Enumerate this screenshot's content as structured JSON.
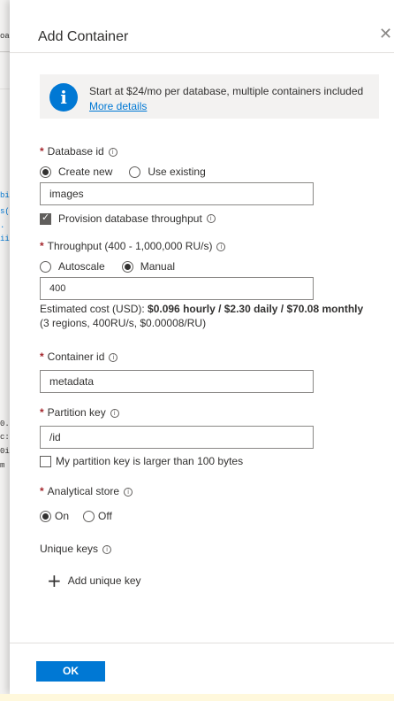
{
  "background": {
    "fragments": [
      "oa",
      "bi",
      "s(",
      ".",
      "ii",
      "0.",
      "c:",
      "0i",
      "m"
    ]
  },
  "dialog": {
    "title": "Add Container",
    "close_icon": "close-icon"
  },
  "info": {
    "icon": "info-icon",
    "text": "Start at $24/mo per database, multiple containers included",
    "link": "More details"
  },
  "database": {
    "label": "Database id",
    "options": [
      "Create new",
      "Use existing"
    ],
    "selected": "Create new",
    "value": "images",
    "provision_label": "Provision database throughput",
    "provision_checked": true
  },
  "throughput": {
    "label": "Throughput (400 - 1,000,000 RU/s)",
    "options": [
      "Autoscale",
      "Manual"
    ],
    "selected": "Manual",
    "value": "400",
    "cost_prefix": "Estimated cost (USD): ",
    "cost_bold": "$0.096 hourly / $2.30 daily / $70.08 monthly",
    "cost_detail": "(3 regions, 400RU/s, $0.00008/RU)"
  },
  "container": {
    "label": "Container id",
    "value": "metadata"
  },
  "partition": {
    "label": "Partition key",
    "value": "/id",
    "large_label": "My partition key is larger than 100 bytes",
    "large_checked": false
  },
  "analytical": {
    "label": "Analytical store",
    "options": [
      "On",
      "Off"
    ],
    "selected": "On"
  },
  "unique_keys": {
    "label": "Unique keys",
    "add_label": "Add unique key"
  },
  "footer": {
    "ok_label": "OK"
  },
  "colors": {
    "accent": "#0078d4",
    "required": "#a4262c"
  }
}
